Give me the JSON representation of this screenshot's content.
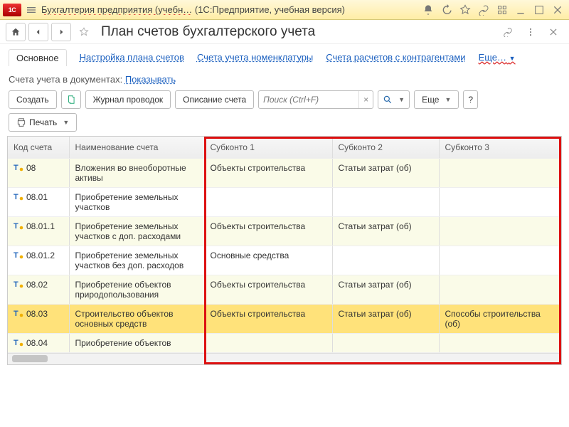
{
  "titlebar": {
    "app_logo_text": "1C",
    "title_a": "Бухгалтерия предприятия (учебн…",
    "title_b": "(1С:Предприятие, учебная версия)"
  },
  "page": {
    "title": "План счетов бухгалтерского учета"
  },
  "tabs": {
    "main": "Основное",
    "plan": "Настройка плана счетов",
    "nomen": "Счета учета номенклатуры",
    "contr": "Счета расчетов с контрагентами",
    "more": "Еще…"
  },
  "filter": {
    "label": "Счета учета в документах:",
    "link": "Показывать"
  },
  "toolbar": {
    "create": "Создать",
    "journal": "Журнал проводок",
    "descr": "Описание счета",
    "search_placeholder": "Поиск (Ctrl+F)",
    "more": "Еще",
    "help": "?",
    "print": "Печать"
  },
  "columns": {
    "code": "Код счета",
    "name": "Наименование счета",
    "s1": "Субконто 1",
    "s2": "Субконто 2",
    "s3": "Субконто 3"
  },
  "rows": [
    {
      "code": "08",
      "name": "Вложения во внеоборотные активы",
      "s1": "Объекты строительства",
      "s2": "Статьи затрат (об)",
      "s3": ""
    },
    {
      "code": "08.01",
      "name": "Приобретение земельных участков",
      "s1": "",
      "s2": "",
      "s3": ""
    },
    {
      "code": "08.01.1",
      "name": "Приобретение земельных участков с доп. расходами",
      "s1": "Объекты строительства",
      "s2": "Статьи затрат (об)",
      "s3": ""
    },
    {
      "code": "08.01.2",
      "name": "Приобретение земельных участков без доп. расходов",
      "s1": "Основные средства",
      "s2": "",
      "s3": ""
    },
    {
      "code": "08.02",
      "name": "Приобретение объектов природопользования",
      "s1": "Объекты строительства",
      "s2": "Статьи затрат (об)",
      "s3": ""
    },
    {
      "code": "08.03",
      "name": "Строительство объектов основных средств",
      "s1": "Объекты строительства",
      "s2": "Статьи затрат (об)",
      "s3": "Способы строительства (об)"
    },
    {
      "code": "08.04",
      "name": "Приобретение объектов",
      "s1": "",
      "s2": "",
      "s3": ""
    }
  ],
  "selected_row_index": 5
}
